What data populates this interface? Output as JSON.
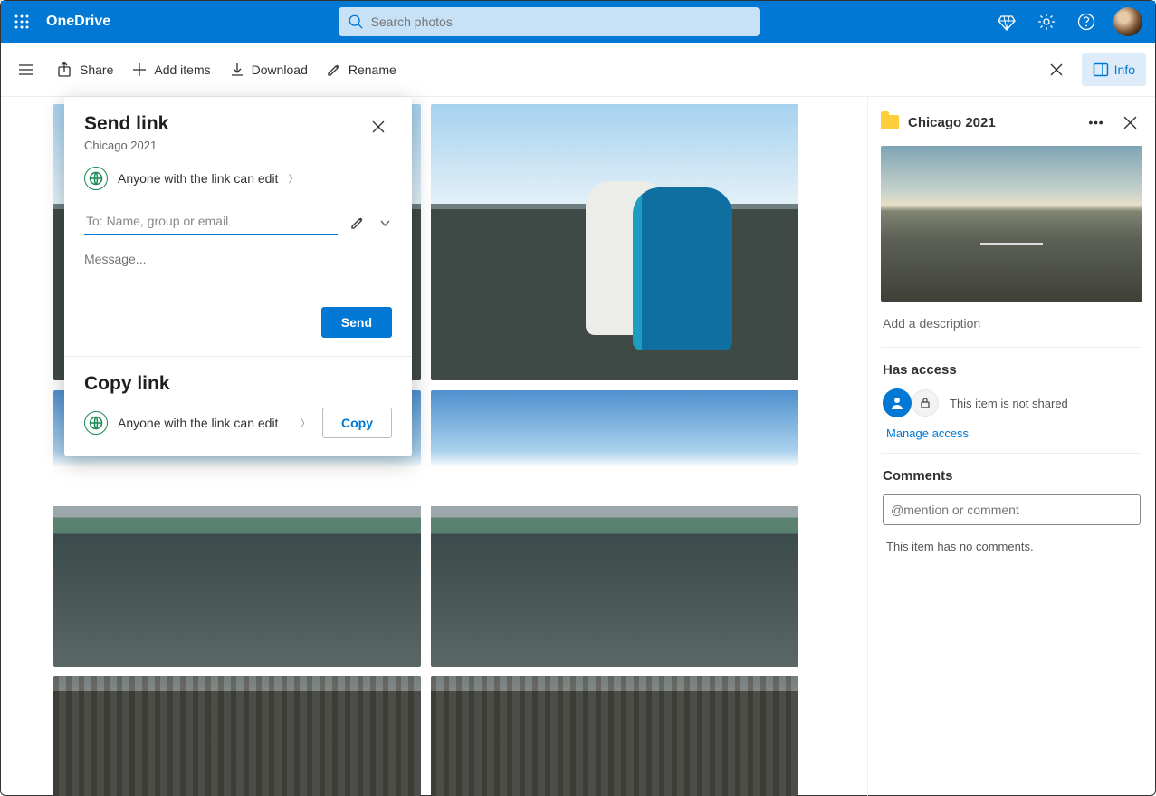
{
  "header": {
    "brand": "OneDrive",
    "search_placeholder": "Search photos"
  },
  "commands": {
    "share": "Share",
    "add": "Add items",
    "download": "Download",
    "rename": "Rename",
    "info": "Info"
  },
  "dialog": {
    "send_title": "Send link",
    "subject": "Chicago 2021",
    "permission": "Anyone with the link can edit",
    "to_placeholder": "To: Name, group or email",
    "message_placeholder": "Message...",
    "send": "Send",
    "copy_title": "Copy link",
    "copy_permission": "Anyone with the link can edit",
    "copy": "Copy"
  },
  "details": {
    "title": "Chicago 2021",
    "add_desc": "Add a description",
    "access_label": "Has access",
    "shared_status": "This item is not shared",
    "manage": "Manage access",
    "comments_label": "Comments",
    "comment_placeholder": "@mention or comment",
    "no_comments": "This item has no comments."
  }
}
